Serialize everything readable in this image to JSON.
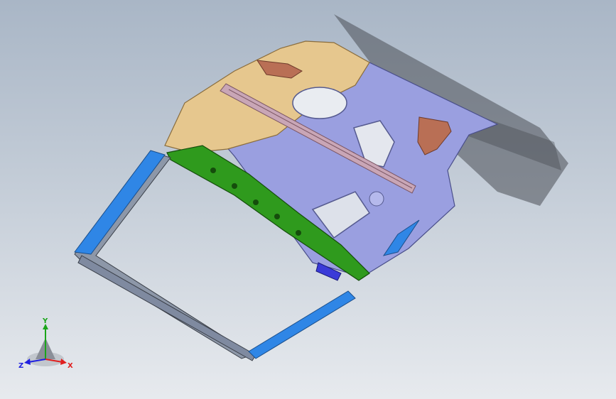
{
  "viewport": {
    "background_top": "#a9b6c6",
    "background_bottom": "#e7eaee"
  },
  "model": {
    "parts": [
      {
        "name": "roof-outer-panel",
        "color": "#9a9fe0"
      },
      {
        "name": "rear-reinforcement",
        "color": "#e6c78e"
      },
      {
        "name": "front-header-rail",
        "color": "#2f9a1d"
      },
      {
        "name": "side-rail-left",
        "color": "#2f86e6"
      },
      {
        "name": "side-rail-right",
        "color": "#2f86e6"
      },
      {
        "name": "bow-crossmember",
        "color": "#c9a6b6"
      },
      {
        "name": "hinge-bracket",
        "color": "#b96f55"
      }
    ]
  },
  "triad": {
    "y_label": "Y",
    "x_label": "X",
    "z_label": "Z",
    "y_color": "#1aa51a",
    "x_color": "#e01f1f",
    "z_color": "#2020e0"
  }
}
